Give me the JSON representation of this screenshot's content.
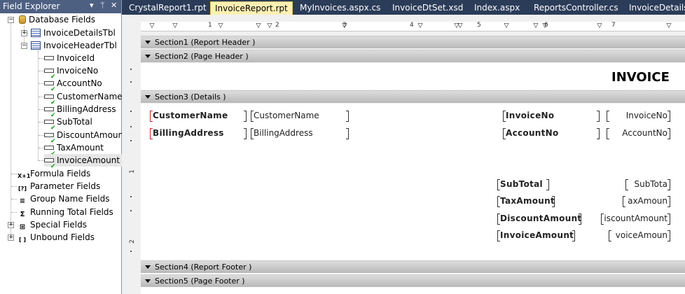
{
  "field_explorer": {
    "title": "Field Explorer",
    "pin_glyph": "▾ ‡ ×",
    "database_fields": "Database Fields",
    "tables": [
      {
        "label": "InvoiceDetailsTbl"
      },
      {
        "label": "InvoiceHeaderTbl"
      }
    ],
    "fields": [
      {
        "label": "InvoiceId"
      },
      {
        "label": "InvoiceNo"
      },
      {
        "label": "AccountNo"
      },
      {
        "label": "CustomerName"
      },
      {
        "label": "BillingAddress"
      },
      {
        "label": "SubTotal"
      },
      {
        "label": "DiscountAmount"
      },
      {
        "label": "TaxAmount"
      },
      {
        "label": "InvoiceAmount"
      }
    ],
    "other_nodes": [
      {
        "label": "Formula Fields",
        "icon": "formula-icon",
        "glyph": "X+1"
      },
      {
        "label": "Parameter Fields",
        "icon": "parameter-icon",
        "glyph": "[?]"
      },
      {
        "label": "Group Name Fields",
        "icon": "group-name-icon",
        "glyph": "≡"
      },
      {
        "label": "Running Total Fields",
        "icon": "running-total-icon",
        "glyph": "Σ"
      },
      {
        "label": "Special Fields",
        "icon": "special-fields-icon",
        "glyph": "⊞"
      },
      {
        "label": "Unbound Fields",
        "icon": "unbound-fields-icon",
        "glyph": "[ ]"
      }
    ]
  },
  "tabs": [
    {
      "label": "CrystalReport1.rpt"
    },
    {
      "label": "InvoiceReport.rpt"
    },
    {
      "label": "MyInvoices.aspx.cs"
    },
    {
      "label": "InvoiceDtSet.xsd"
    },
    {
      "label": "Index.aspx"
    },
    {
      "label": "ReportsController.cs"
    },
    {
      "label": "InvoiceDetails."
    }
  ],
  "ruler": {
    "numbers": [
      "1",
      "2",
      "3",
      "4",
      "5",
      "6",
      "7"
    ]
  },
  "vruler": {
    "numbers": [
      "1",
      "2"
    ]
  },
  "sections": {
    "s1": "Section1 (Report Header )",
    "s2": "Section2 (Page Header )",
    "s3": "Section3 (Details )",
    "s4": "Section4 (Report Footer )",
    "s5": "Section5 (Page Footer )"
  },
  "report": {
    "title": "INVOICE",
    "customer_name_label": "CustomerName",
    "customer_name_field": "CustomerName",
    "billing_address_label": "BillingAddress",
    "billing_address_field": "BillingAddress",
    "invoice_no_label": "InvoiceNo",
    "invoice_no_field": "InvoiceNo",
    "account_no_label": "AccountNo",
    "account_no_field": "AccountNo",
    "subtotal_label": "SubTotal",
    "subtotal_field": "SubTota",
    "tax_label": "TaxAmount",
    "tax_field": "axAmoun",
    "discount_label": "DiscountAmount",
    "discount_field": "iscountAmount",
    "invoice_amount_label": "InvoiceAmount",
    "invoice_amount_field": "voiceAmoun"
  }
}
